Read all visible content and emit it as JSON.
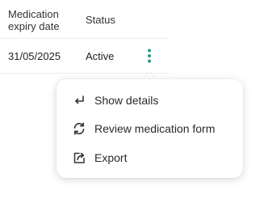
{
  "table": {
    "columns": [
      "Medication expiry date",
      "Status"
    ],
    "rows": [
      {
        "expiry_date": "31/05/2025",
        "status": "Active"
      }
    ]
  },
  "row_actions": {
    "trigger_icon": "kebab-vertical-icon",
    "accent_color": "#2a9a8a"
  },
  "menu": {
    "items": [
      {
        "label": "Show details",
        "icon": "return-arrow-icon"
      },
      {
        "label": "Review medication form",
        "icon": "refresh-icon"
      },
      {
        "label": "Export",
        "icon": "export-icon"
      }
    ]
  }
}
